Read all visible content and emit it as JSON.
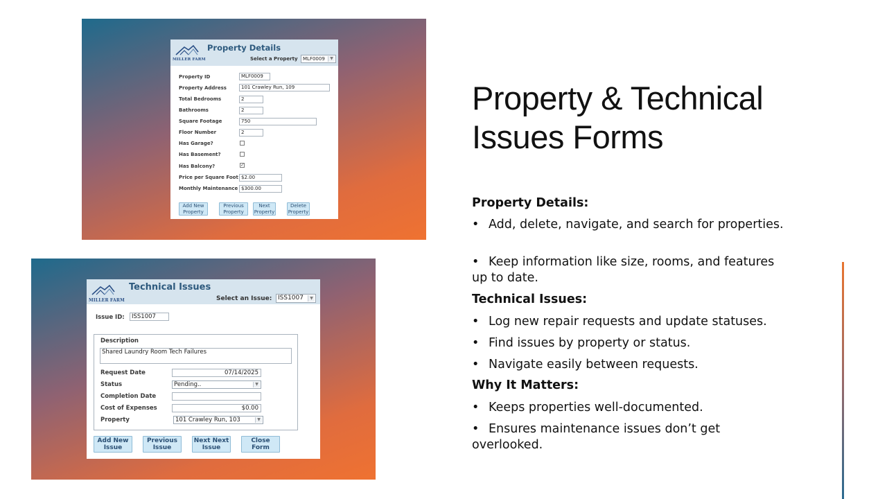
{
  "slide": {
    "title": "Property & Technical Issues Forms",
    "accent_colors": [
      "#1f6a8c",
      "#ef7231"
    ]
  },
  "logo": {
    "text": "MILLER FARM"
  },
  "property_form": {
    "title": "Property Details",
    "select_label": "Select a Property",
    "select_value": "MLF0009",
    "fields": {
      "property_id": {
        "label": "Property ID",
        "value": "MLF0009"
      },
      "address": {
        "label": "Property Address",
        "value": "101 Crawley Run, 109"
      },
      "bedrooms": {
        "label": "Total Bedrooms",
        "value": "2"
      },
      "bathrooms": {
        "label": "Bathrooms",
        "value": "2"
      },
      "sqft": {
        "label": "Square Footage",
        "value": "750"
      },
      "floor": {
        "label": "Floor Number",
        "value": "2"
      },
      "garage": {
        "label": "Has Garage?",
        "checked": false
      },
      "basement": {
        "label": "Has Basement?",
        "checked": false
      },
      "balcony": {
        "label": "Has Balcony?",
        "checked": true
      },
      "price_sqft": {
        "label": "Price per Square Foot",
        "value": "$2.00"
      },
      "maintenance": {
        "label": "Monthly Maintenance",
        "value": "$300.00"
      }
    },
    "buttons": {
      "add": [
        "Add New",
        "Property"
      ],
      "previous": [
        "Previous",
        "Property"
      ],
      "next": [
        "Next",
        "Property"
      ],
      "delete": [
        "Delete",
        "Property"
      ]
    }
  },
  "issues_form": {
    "title": "Technical Issues",
    "select_label": "Select an Issue:",
    "select_value": "ISS1007",
    "issue_id_label": "Issue ID:",
    "issue_id_value": "ISS1007",
    "fields": {
      "description": {
        "label": "Description",
        "value": "Shared Laundry Room Tech Failures"
      },
      "request_date": {
        "label": "Request Date",
        "value": "07/14/2025"
      },
      "status": {
        "label": "Status",
        "value": "Pending.."
      },
      "completion_date": {
        "label": "Completion Date",
        "value": ""
      },
      "cost": {
        "label": "Cost of Expenses",
        "value": "$0.00"
      },
      "property": {
        "label": "Property",
        "value": "101 Crawley Run, 103"
      }
    },
    "buttons": {
      "add": [
        "Add New",
        "Issue"
      ],
      "previous": [
        "Previous",
        "Issue"
      ],
      "next": [
        "Next Next",
        "Issue"
      ],
      "close": [
        "Close Form"
      ]
    }
  },
  "sections": {
    "property": {
      "heading": "Property Details:",
      "bullets": [
        "Add, delete, navigate, and search for properties.",
        "Keep information like size, rooms, and features up to date."
      ]
    },
    "issues": {
      "heading": "Technical Issues:",
      "bullets": [
        "Log new repair requests and update statuses.",
        "Find issues by property or status.",
        "Navigate easily between requests."
      ]
    },
    "why": {
      "heading": "Why It Matters:",
      "bullets": [
        "Keeps properties well-documented.",
        "Ensures maintenance issues don’t get overlooked."
      ]
    }
  }
}
